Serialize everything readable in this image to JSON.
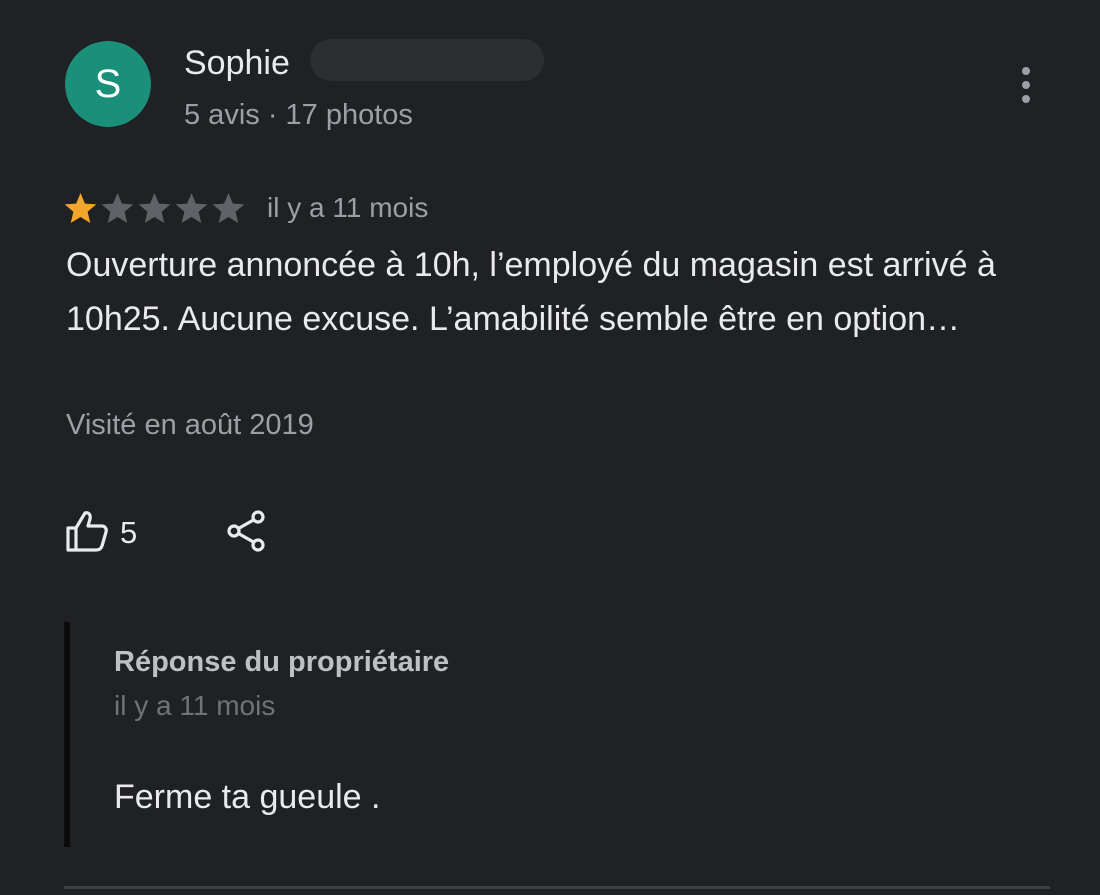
{
  "review": {
    "author": {
      "initial": "S",
      "name": "Sophie",
      "stats": "5 avis · 17 photos",
      "avatar_color": "#1a8f7a"
    },
    "rating": 1,
    "rating_max": 5,
    "star_filled_color": "#f4a62a",
    "star_empty_color": "#5f6368",
    "date": "il y a 11 mois",
    "text": "Ouverture annoncée à 10h, l’employé du magasin est arrivé à 10h25. Aucune excuse. L’amabilité semble être en option…",
    "visited": "Visité en août 2019",
    "likes": "5",
    "icons": {
      "more": "more-vert-icon",
      "like": "thumbs-up-icon",
      "share": "share-icon"
    }
  },
  "owner_reply": {
    "title": "Réponse du propriétaire",
    "date": "il y a 11 mois",
    "text": "Ferme ta gueule ."
  }
}
